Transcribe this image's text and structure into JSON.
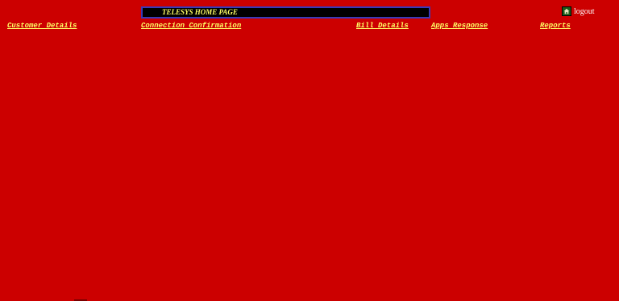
{
  "header": {
    "title": "TELESYS HOME PAGE",
    "logout_label": "logout",
    "logout_icon": "home-icon"
  },
  "nav": {
    "customer_details": "Customer Details",
    "connection_confirmation": "Connection Confirmation",
    "bill_details": "Bill Details",
    "apps_response": "Apps Response",
    "reports": "Reports"
  },
  "colors": {
    "background": "#cc0000",
    "link": "#ffff66",
    "title_bar": "#000000",
    "title_border": "#3a3ab8"
  }
}
